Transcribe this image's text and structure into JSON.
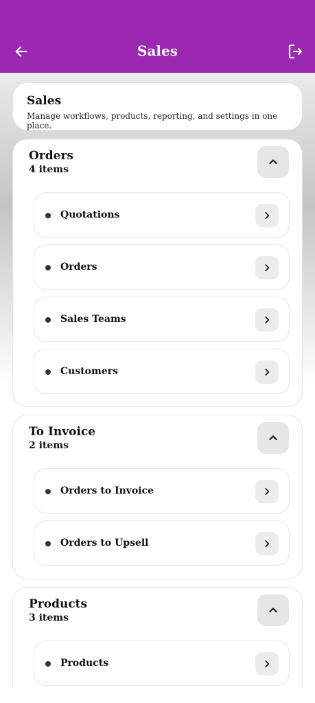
{
  "appbar": {
    "title": "Sales",
    "back_icon": "arrow-left-icon",
    "logout_icon": "logout-icon",
    "color": "#9c27b0"
  },
  "header": {
    "title": "Sales",
    "description": "Manage workflows, products, reporting, and settings in one place."
  },
  "sections": [
    {
      "title": "Orders",
      "count": "4 items",
      "items": [
        {
          "label": "Quotations"
        },
        {
          "label": "Orders"
        },
        {
          "label": "Sales Teams"
        },
        {
          "label": "Customers"
        }
      ]
    },
    {
      "title": "To Invoice",
      "count": "2 items",
      "items": [
        {
          "label": "Orders to Invoice"
        },
        {
          "label": "Orders to Upsell"
        }
      ]
    },
    {
      "title": "Products",
      "count": "3 items",
      "items": [
        {
          "label": "Products"
        }
      ]
    }
  ]
}
